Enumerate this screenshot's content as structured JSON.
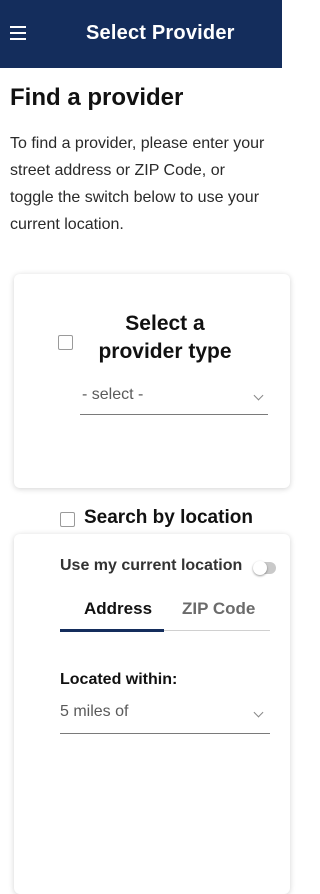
{
  "header": {
    "title": "Select Provider",
    "menu_icon": "hamburger-menu-icon"
  },
  "page": {
    "title": "Find a provider",
    "intro": "To find a provider, please enter your street address or ZIP Code, or toggle the switch below to use your current location."
  },
  "provider_type": {
    "title": "Select a provider type",
    "select_value": "- select -"
  },
  "location": {
    "title": "Search by location",
    "use_current": "Use my current location",
    "tabs": [
      "Address",
      "ZIP Code"
    ],
    "active_tab": "Address",
    "within_label": "Located within:",
    "within_value": "5 miles of"
  },
  "colors": {
    "header_bg": "#142d5c",
    "accent": "#142d5c"
  }
}
